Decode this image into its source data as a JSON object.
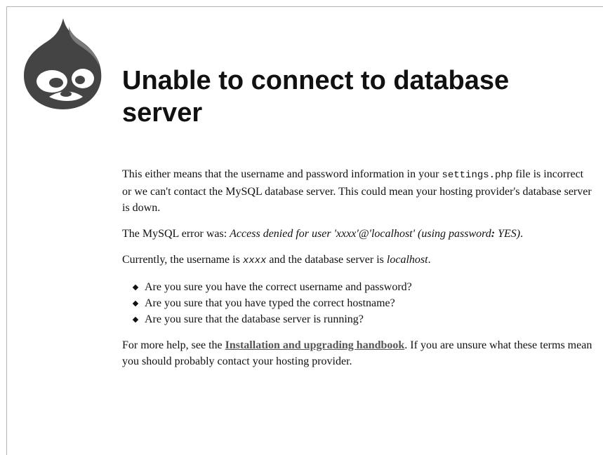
{
  "page": {
    "title": "Unable to connect to database server"
  },
  "logo": {
    "icon": "drupal-drop-icon"
  },
  "intro": {
    "text_before": "This either means that the username and password information in your ",
    "settings_file": "settings.php",
    "text_after": " file is incorrect or we can't contact the MySQL database server. This could mean your hosting provider's database server is down."
  },
  "error": {
    "prefix": "The MySQL error was: ",
    "message_before": "Access denied for user 'xxxx'@'localhost' (using password",
    "message_colon": ":",
    "message_after": " YES)",
    "suffix": "."
  },
  "current": {
    "prefix": "Currently, the username is ",
    "username": "xxxx",
    "middle": " and the database server is ",
    "server": "localhost",
    "suffix": "."
  },
  "checklist": [
    "Are you sure you have the correct username and password?",
    "Are you sure that you have typed the correct hostname?",
    "Are you sure that the database server is running?"
  ],
  "help": {
    "prefix": "For more help, see the ",
    "link_text": "Installation and upgrading handbook",
    "suffix": ". If you are unsure what these terms mean you should probably contact your hosting provider."
  }
}
